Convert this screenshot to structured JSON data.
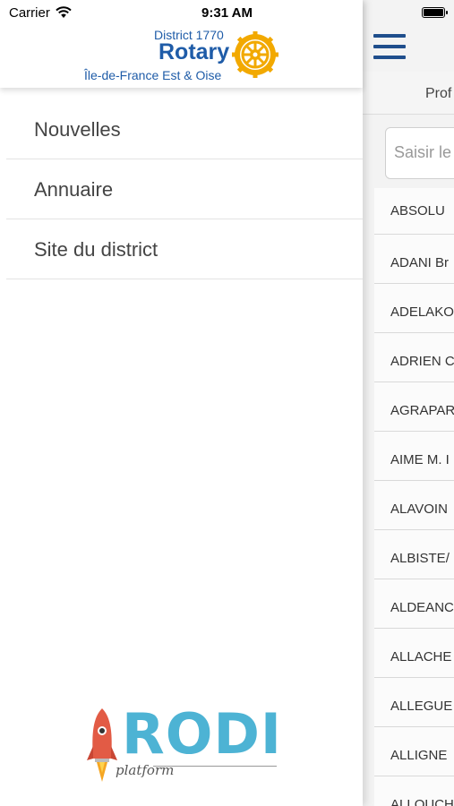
{
  "status_bar": {
    "carrier": "Carrier",
    "time": "9:31 AM",
    "battery_level": 1.0
  },
  "drawer": {
    "logo": {
      "district": "District 1770",
      "name": "Rotary",
      "region": "Île-de-France Est & Oise"
    },
    "menu": [
      {
        "label": "Nouvelles"
      },
      {
        "label": "Annuaire"
      },
      {
        "label": "Site du district"
      }
    ],
    "footer_logo": {
      "name": "RODI",
      "subtitle": "platform"
    }
  },
  "behind": {
    "tab_label": "Prof",
    "search_placeholder": "Saisir le",
    "rows": [
      "ABSOLU",
      "ADANI Br",
      "ADELAKO",
      "ADRIEN C",
      "AGRAPAR",
      "AIME M. I",
      "ALAVOIN",
      "ALBISTE/",
      "ALDEANC",
      "ALLACHE",
      "ALLEGUE",
      "ALLIGNE",
      "ALLOUCH"
    ]
  },
  "colors": {
    "brand_blue": "#1f5ca8",
    "rotary_gold": "#f2a900",
    "rodi_blue": "#4db3d4",
    "rocket_red": "#e25b45"
  }
}
